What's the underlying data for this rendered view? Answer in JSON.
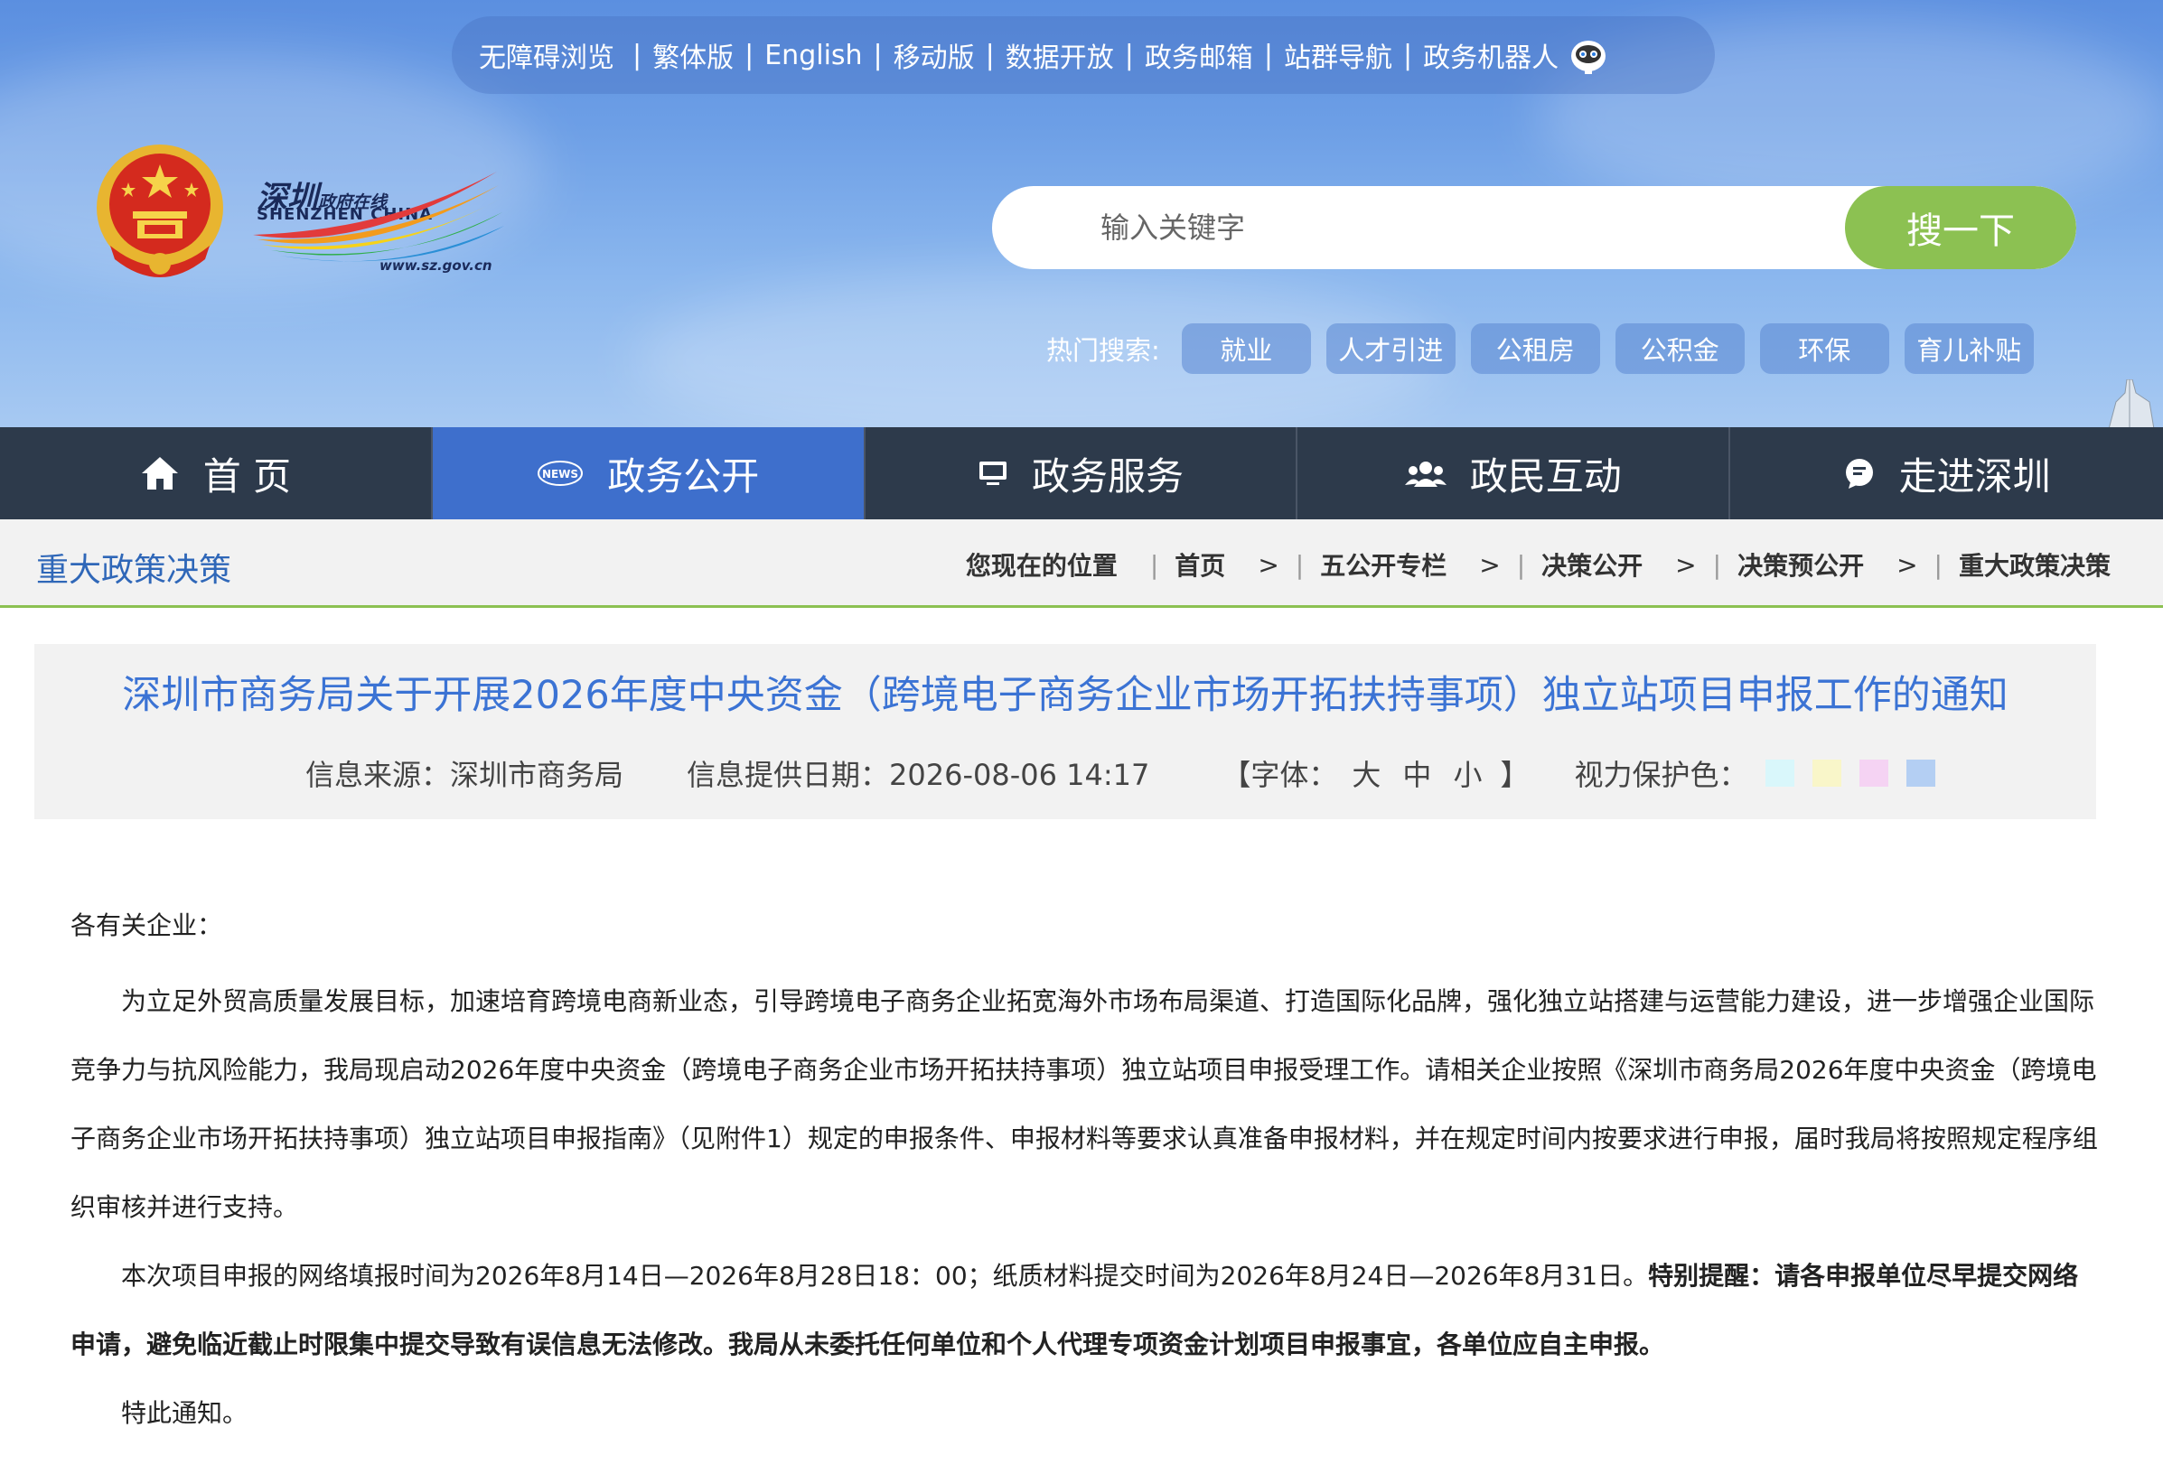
{
  "topbar": {
    "links": [
      "无障碍浏览",
      "繁体版",
      "English",
      "移动版",
      "数据开放",
      "政务邮箱",
      "站群导航",
      "政务机器人"
    ]
  },
  "logo": {
    "cn_main": "深圳",
    "cn_sub": "政府在线",
    "en": "SHENZHEN  CHINA",
    "url": "www.sz.gov.cn"
  },
  "search": {
    "placeholder": "输入关键字",
    "button": "搜一下"
  },
  "hot": {
    "label": "热门搜索:",
    "tags": [
      "就业",
      "人才引进",
      "公租房",
      "公积金",
      "环保",
      "育儿补贴"
    ]
  },
  "nav": {
    "items": [
      {
        "label": "首 页",
        "icon": "home-icon"
      },
      {
        "label": "政务公开",
        "icon": "news-icon"
      },
      {
        "label": "政务服务",
        "icon": "monitor-icon"
      },
      {
        "label": "政民互动",
        "icon": "people-icon"
      },
      {
        "label": "走进深圳",
        "icon": "chat-icon"
      }
    ],
    "active_index": 1
  },
  "section": {
    "title": "重大政策决策"
  },
  "breadcrumb": {
    "head": "您现在的位置",
    "items": [
      "首页",
      "五公开专栏",
      "决策公开",
      "决策预公开",
      "重大政策决策"
    ],
    "arrow": ">"
  },
  "article": {
    "title": "深圳市商务局关于开展2026年度中央资金（跨境电子商务企业市场开拓扶持事项）独立站项目申报工作的通知",
    "source": "信息来源：深圳市商务局",
    "date": "信息提供日期：2026-08-06 14:17",
    "font_open": "【字体：",
    "font_sizes": [
      "大",
      "中",
      "小"
    ],
    "font_close": "】",
    "eye_label": "视力保护色：",
    "eye_colors": [
      "#d9f7fb",
      "#f9f6c9",
      "#f5d3f3",
      "#b4cff3"
    ],
    "greeting": "各有关企业：",
    "para1": "为立足外贸高质量发展目标，加速培育跨境电商新业态，引导跨境电子商务企业拓宽海外市场布局渠道、打造国际化品牌，强化独立站搭建与运营能力建设，进一步增强企业国际竞争力与抗风险能力，我局现启动2026年度中央资金（跨境电子商务企业市场开拓扶持事项）独立站项目申报受理工作。请相关企业按照《深圳市商务局2026年度中央资金（跨境电子商务企业市场开拓扶持事项）独立站项目申报指南》（见附件1）规定的申报条件、申报材料等要求认真准备申报材料，并在规定时间内按要求进行申报，届时我局将按照规定程序组织审核并进行支持。",
    "para2_normal": "本次项目申报的网络填报时间为2026年8月14日—2026年8月28日18：00；纸质材料提交时间为2026年8月24日—2026年8月31日。",
    "para2_bold": "特别提醒：请各申报单位尽早提交网络申请，避免临近截止时限集中提交导致有误信息无法修改。我局从未委托任何单位和个人代理专项资金计划项目申报事宜，各单位应自主申报。",
    "closing": "特此通知。"
  },
  "colors": {
    "nav_bg": "#2d3a4b",
    "nav_active": "#3e6fcc",
    "search_btn": "#8cc152",
    "title_blue": "#3b73d4",
    "section_blue": "#2f67b8"
  }
}
